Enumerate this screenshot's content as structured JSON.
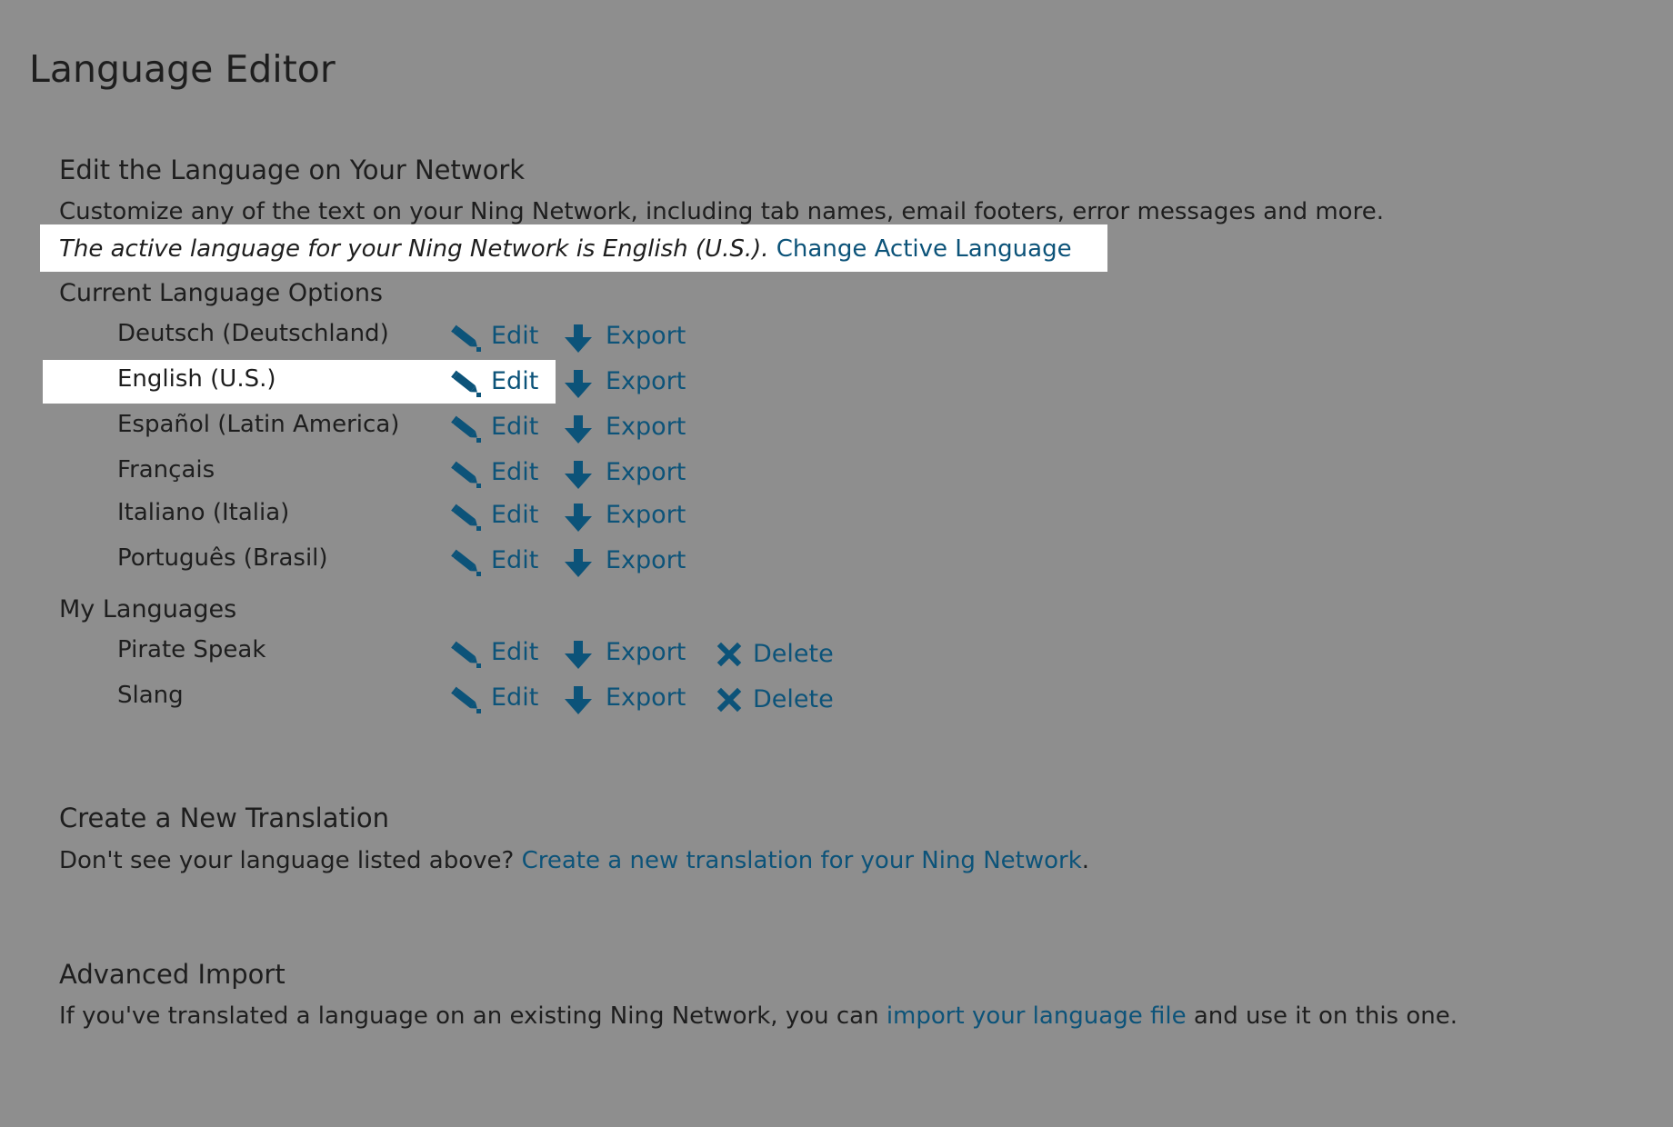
{
  "page": {
    "title": "Language Editor"
  },
  "edit_section": {
    "heading": "Edit the Language on Your Network",
    "description": "Customize any of the text on your Ning Network, including tab names, email footers, error messages and more.",
    "active_text": "The active language for your Ning Network is English (U.S.).",
    "change_link": "Change Active Language"
  },
  "current_options": {
    "heading": "Current Language Options",
    "languages": [
      {
        "name": "Deutsch (Deutschland)",
        "edit": "Edit",
        "export": "Export"
      },
      {
        "name": "English (U.S.)",
        "edit": "Edit",
        "export": "Export"
      },
      {
        "name": "Español (Latin America)",
        "edit": "Edit",
        "export": "Export"
      },
      {
        "name": "Français",
        "edit": "Edit",
        "export": "Export"
      },
      {
        "name": "Italiano (Italia)",
        "edit": "Edit",
        "export": "Export"
      },
      {
        "name": "Português (Brasil)",
        "edit": "Edit",
        "export": "Export"
      }
    ]
  },
  "my_languages": {
    "heading": "My Languages",
    "languages": [
      {
        "name": "Pirate Speak",
        "edit": "Edit",
        "export": "Export",
        "delete": "Delete"
      },
      {
        "name": "Slang",
        "edit": "Edit",
        "export": "Export",
        "delete": "Delete"
      }
    ]
  },
  "create_section": {
    "heading": "Create a New Translation",
    "text": "Don't see your language listed above?",
    "link": "Create a new translation for your Ning Network",
    "suffix": "."
  },
  "import_section": {
    "heading": "Advanced Import",
    "text_before": "If you've translated a language on an existing Ning Network, you can",
    "link": "import your language file",
    "text_after": "and use it on this one."
  },
  "icons": {
    "edit": "pencil-icon",
    "export": "download-arrow-icon",
    "delete": "close-x-icon"
  },
  "colors": {
    "background": "#8e8e8e",
    "link": "#0c5379",
    "highlight": "#ffffff"
  }
}
